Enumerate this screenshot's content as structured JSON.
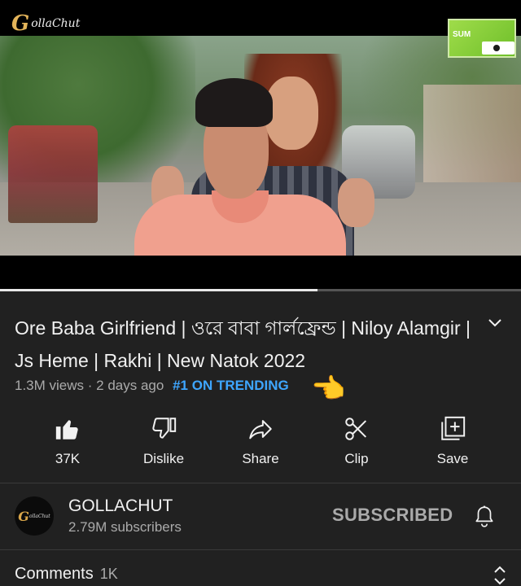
{
  "player": {
    "logo_initial": "G",
    "logo_text": "ollaChut",
    "subscribe_badge_text": "SUM",
    "progress": 0.61,
    "colors": {
      "progress_fill": "#e8e8e8",
      "progress_track": "#555555"
    }
  },
  "video": {
    "title": "Ore Baba Girlfriend | ওরে বাবা গার্লফ্রেন্ড | Niloy Alamgir | Js Heme | Rakhi |  New Natok 2022",
    "views": "1.3M views",
    "separator": "·",
    "age": "2 days ago",
    "trending": "#1 ON TRENDING",
    "trending_emoji": "👈",
    "expand_icon": "chevron-down-icon"
  },
  "actions": [
    {
      "label": "37K",
      "icon": "thumbs-up-filled-icon"
    },
    {
      "label": "Dislike",
      "icon": "thumbs-down-icon"
    },
    {
      "label": "Share",
      "icon": "share-arrow-icon"
    },
    {
      "label": "Clip",
      "icon": "scissors-icon"
    },
    {
      "label": "Save",
      "icon": "add-to-playlist-icon"
    }
  ],
  "channel": {
    "avatar_initial": "G",
    "avatar_text": "ollaChut",
    "name": "GOLLACHUT",
    "subscribers": "2.79M subscribers",
    "subscribe_state": "SUBSCRIBED",
    "bell_icon": "bell-icon"
  },
  "comments": {
    "label": "Comments",
    "count": "1K",
    "sort_icon": "expand-collapse-icon"
  },
  "colors": {
    "background": "#212121",
    "text_primary": "#f1f1f1",
    "text_secondary": "#aaaaaa",
    "trending_blue": "#3ea6ff"
  }
}
